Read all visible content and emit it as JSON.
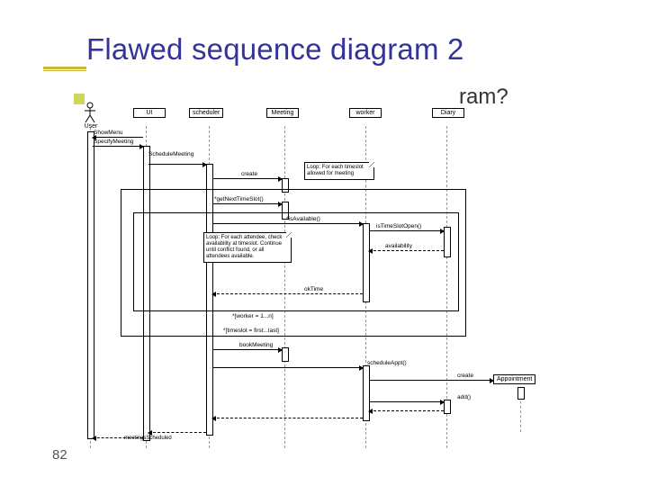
{
  "slide": {
    "title": "Flawed sequence diagram 2",
    "stray_text_fragment": "ram?",
    "page_number": "82",
    "footer_cut": "meetingsScheduled"
  },
  "diagram": {
    "actor": {
      "label": "User"
    },
    "lifelines": {
      "ui": "UI",
      "scheduler": "scheduler",
      "meeting": "Meeting",
      "worker": "worker",
      "diary": "Diary",
      "appointment": "Appointment"
    },
    "messages": {
      "showMenu": "ShowMenu",
      "specifyMeeting": "SpecifyMeeting",
      "scheduleMeeting": "ScheduleMeeting",
      "create": "create",
      "getNextTimeSlot": "*getNextTimeSlot()",
      "isAvailable": "*isAvailable()",
      "isTimeSlotOpen": "isTimeSlotOpen()",
      "availability": "availability",
      "okTime": "okTime",
      "loopWorker": "*[worker = 1...n]",
      "loopTimeslot": "*[timeslot = first...last]",
      "bookMeeting": "bookMeeting",
      "scheduleAppt": "scheduleAppt()",
      "create2": "create",
      "add": "add()"
    },
    "notes": {
      "outerLoop": "Loop: For each\ntimeslot allowed\nfor meeting",
      "innerLoop": "Loop: For each attendee,\ncheck availability at\ntimeslot. Continue until\nconflict found, or all\nattendees available."
    }
  },
  "chart_data": {
    "type": "table",
    "description": "UML sequence diagram depicting scheduling a meeting via UI → scheduler → Meeting → worker → Diary lifelines with nested loop frames",
    "lifelines": [
      "User",
      "UI",
      "scheduler",
      "Meeting",
      "worker",
      "Diary",
      "Appointment"
    ],
    "interactions": [
      {
        "from": "UI",
        "to": "User",
        "label": "ShowMenu",
        "kind": "return"
      },
      {
        "from": "User",
        "to": "UI",
        "label": "SpecifyMeeting",
        "kind": "call"
      },
      {
        "from": "UI",
        "to": "scheduler",
        "label": "ScheduleMeeting",
        "kind": "call"
      },
      {
        "from": "scheduler",
        "to": "Meeting",
        "label": "create",
        "kind": "create"
      },
      {
        "frame": "loop",
        "label": "*[timeslot = first...last]",
        "note": "Loop: For each timeslot allowed for meeting",
        "children": [
          {
            "from": "scheduler",
            "to": "Meeting",
            "label": "*getNextTimeSlot()",
            "kind": "call"
          },
          {
            "frame": "loop",
            "label": "*[worker = 1...n]",
            "note": "Loop: For each attendee, check availability at timeslot. Continue until conflict found, or all attendees available.",
            "children": [
              {
                "from": "scheduler",
                "to": "worker",
                "label": "*isAvailable()",
                "kind": "call"
              },
              {
                "from": "worker",
                "to": "Diary",
                "label": "isTimeSlotOpen()",
                "kind": "call"
              },
              {
                "from": "Diary",
                "to": "worker",
                "label": "availability",
                "kind": "return"
              },
              {
                "from": "worker",
                "to": "scheduler",
                "label": "okTime",
                "kind": "return"
              }
            ]
          }
        ]
      },
      {
        "from": "scheduler",
        "to": "Meeting",
        "label": "bookMeeting",
        "kind": "call"
      },
      {
        "from": "scheduler",
        "to": "worker",
        "label": "scheduleAppt()",
        "kind": "call"
      },
      {
        "from": "worker",
        "to": "Appointment",
        "label": "create",
        "kind": "create"
      },
      {
        "from": "worker",
        "to": "Diary",
        "label": "add()",
        "kind": "call"
      },
      {
        "from": "scheduler",
        "to": "UI",
        "label": "meetingsScheduled",
        "kind": "return"
      }
    ]
  }
}
